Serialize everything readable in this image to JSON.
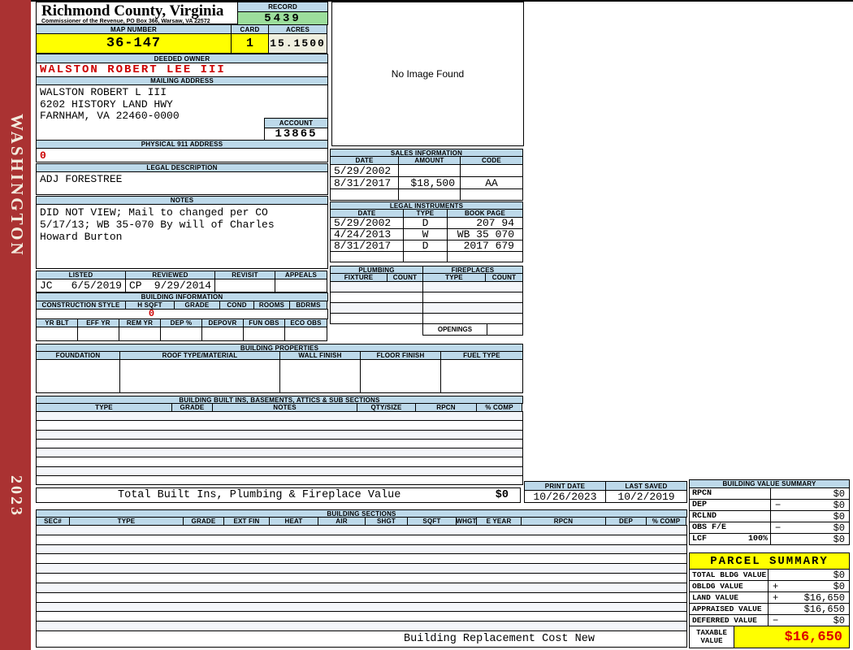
{
  "colors": {
    "header_blue": "#BDD9EA",
    "record_green": "#9CDE9C",
    "highlight_yellow": "#FFFF00",
    "acres_cream": "#EFEFDF",
    "value_red": "#CC0000",
    "banner_red": "#AA3232"
  },
  "sidebar": {
    "county": "WASHINGTON",
    "year": "2023"
  },
  "header": {
    "county_title": "Richmond County, Virginia",
    "commissioner_line": "Commissioner of the Revenue, PO Box 366, Warsaw, VA 22572",
    "record_label": "RECORD",
    "record_value": "5439",
    "map_number_label": "MAP NUMBER",
    "map_number": "36-147",
    "card_label": "CARD",
    "card": "1",
    "acres_label": "ACRES",
    "acres": "15.1500"
  },
  "owner": {
    "deeded_owner_label": "DEEDED OWNER",
    "deeded_owner": "WALSTON ROBERT LEE III",
    "mailing_address_label": "MAILING ADDRESS",
    "mailing_lines": [
      "WALSTON ROBERT L III",
      "6202 HISTORY LAND HWY",
      "",
      "FARNHAM, VA 22460-0000"
    ],
    "account_label": "ACCOUNT",
    "account": "13865",
    "physical_label": "PHYSICAL 911 ADDRESS",
    "physical_value": "0",
    "legal_label": "LEGAL DESCRIPTION",
    "legal_value": "ADJ FORESTREE",
    "notes_label": "NOTES",
    "notes_lines": [
      "DID NOT VIEW; Mail to changed per CO",
      "5/17/13; WB 35-070 By will of Charles",
      "Howard Burton"
    ]
  },
  "review": {
    "headers": [
      "LISTED",
      "REVIEWED",
      "REVISIT",
      "APPEALS"
    ],
    "listed_by": "JC",
    "listed_date": "6/5/2019",
    "reviewed_by": "CP",
    "reviewed_date": "9/29/2014",
    "revisit": "",
    "appeals": ""
  },
  "building_info": {
    "title": "BUILDING INFORMATION",
    "row1_headers": [
      "CONSTRUCTION STYLE",
      "H SQFT",
      "GRADE",
      "COND",
      "ROOMS",
      "BDRMS"
    ],
    "hsqft_value": "0",
    "row2_headers": [
      "YR BLT",
      "EFF YR",
      "REM YR",
      "DEP %",
      "DEPOVR",
      "FUN OBS",
      "ECO OBS"
    ]
  },
  "image_box": {
    "placeholder": "No Image Found"
  },
  "sales": {
    "title": "SALES INFORMATION",
    "headers": [
      "DATE",
      "AMOUNT",
      "CODE"
    ],
    "rows": [
      [
        "5/29/2002",
        "",
        ""
      ],
      [
        "8/31/2017",
        "$18,500",
        "AA"
      ],
      [
        "",
        "",
        ""
      ]
    ]
  },
  "legal_instruments": {
    "title": "LEGAL INSTRUMENTS",
    "headers": [
      "DATE",
      "TYPE",
      "BOOK PAGE"
    ],
    "rows": [
      [
        "5/29/2002",
        "D",
        "207 94"
      ],
      [
        "4/24/2013",
        "W",
        "WB 35 070"
      ],
      [
        "8/31/2017",
        "D",
        "2017 679"
      ],
      [
        "",
        "",
        ""
      ]
    ]
  },
  "plumbing": {
    "title": "PLUMBING",
    "headers": [
      "FIXTURE",
      "COUNT"
    ]
  },
  "fireplaces": {
    "title": "FIREPLACES",
    "headers": [
      "TYPE",
      "COUNT"
    ],
    "openings_label": "OPENINGS"
  },
  "building_properties": {
    "title": "BUILDING PROPERTIES",
    "headers": [
      "FOUNDATION",
      "ROOF TYPE/MATERIAL",
      "WALL FINISH",
      "FLOOR FINISH",
      "FUEL TYPE"
    ]
  },
  "built_ins": {
    "title": "BUILDING BUILT INS, BASEMENTS, ATTICS & SUB SECTIONS",
    "headers": [
      "TYPE",
      "GRADE",
      "NOTES",
      "QTY/SIZE",
      "RPCN",
      "% COMP"
    ],
    "total_label": "Total Built Ins, Plumbing & Fireplace Value",
    "total_value": "$0"
  },
  "print_info": {
    "print_date_label": "PRINT DATE",
    "print_date": "10/26/2023",
    "last_saved_label": "LAST SAVED",
    "last_saved": "10/2/2019"
  },
  "building_sections": {
    "title": "BUILDING SECTIONS",
    "headers": [
      "SEC#",
      "TYPE",
      "GRADE",
      "EXT FIN",
      "HEAT",
      "AIR",
      "SHGT",
      "SQFT",
      "WHGT",
      "E YEAR",
      "RPCN",
      "DEP",
      "% COMP"
    ],
    "footer": "Building Replacement Cost New"
  },
  "building_value_summary": {
    "title": "BUILDING VALUE SUMMARY",
    "rows": [
      {
        "label": "RPCN",
        "pct": "",
        "op": "",
        "value": "$0"
      },
      {
        "label": "DEP",
        "pct": "",
        "op": "−",
        "value": "$0"
      },
      {
        "label": "RCLND",
        "pct": "",
        "op": "",
        "value": "$0"
      },
      {
        "label": "OBS F/E",
        "pct": "",
        "op": "−",
        "value": "$0"
      },
      {
        "label": "LCF",
        "pct": "100%",
        "op": "",
        "value": "$0"
      }
    ]
  },
  "parcel_summary": {
    "title": "PARCEL SUMMARY",
    "rows": [
      {
        "label": "TOTAL BLDG VALUE",
        "op": "",
        "value": "$0"
      },
      {
        "label": "OBLDG VALUE",
        "op": "+",
        "value": "$0"
      },
      {
        "label": "LAND VALUE",
        "op": "+",
        "value": "$16,650"
      },
      {
        "label": "APPRAISED VALUE",
        "op": "",
        "value": "$16,650"
      },
      {
        "label": "DEFERRED VALUE",
        "op": "−",
        "value": "$0"
      }
    ],
    "taxable_label": "TAXABLE VALUE",
    "taxable_value": "$16,650"
  }
}
